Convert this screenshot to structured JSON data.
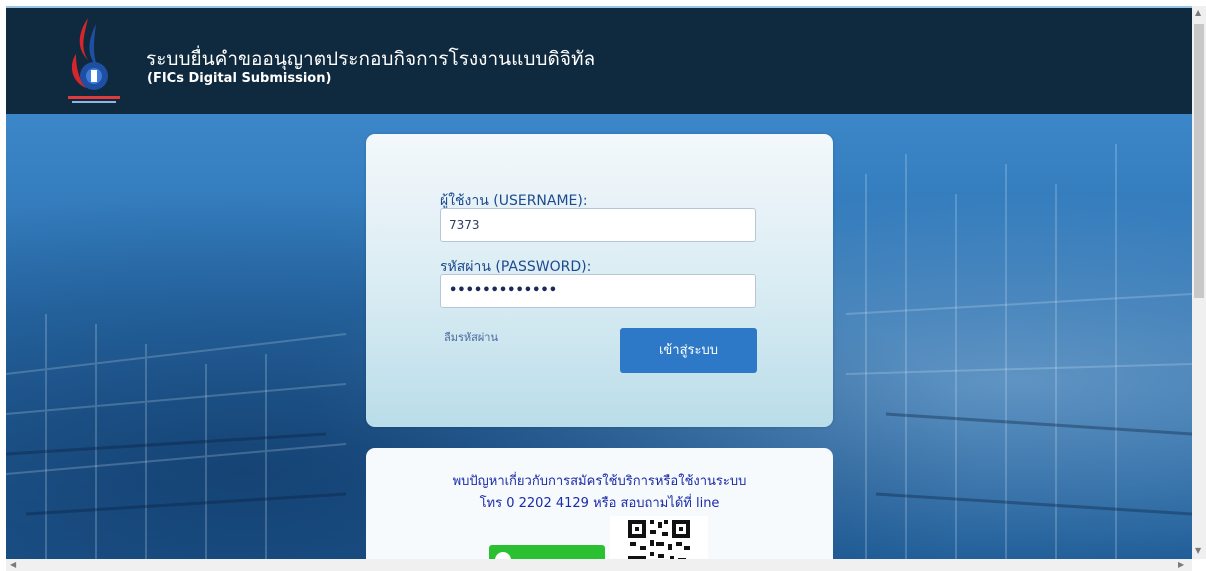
{
  "header": {
    "title": "ระบบยื่นคำขออนุญาตประกอบกิจการโรงงานแบบดิจิทัล",
    "subtitle": "(FICs Digital Submission)",
    "logo_icon": "department-of-industrial-works-logo"
  },
  "login": {
    "username_label": "ผู้ใช้งาน (USERNAME):",
    "username_value": "7373",
    "password_label": "รหัสผ่าน (PASSWORD):",
    "password_value": "•••••••••••••",
    "forgot_label": "ลืมรหัสผ่าน",
    "submit_label": "เข้าสู่ระบบ"
  },
  "help": {
    "line1": "พบปัญหาเกี่ยวกับการสมัครใช้บริการหรือใช้งานระบบ",
    "line2": "โทร 0 2202 4129 หรือ สอบถามได้ที่ line",
    "line_button_icon": "line-app-icon",
    "qr_icon": "qr-code-icon"
  },
  "colors": {
    "header_bg": "#0f2a3f",
    "primary_button": "#2d79c7",
    "line_green": "#2bbf32"
  }
}
